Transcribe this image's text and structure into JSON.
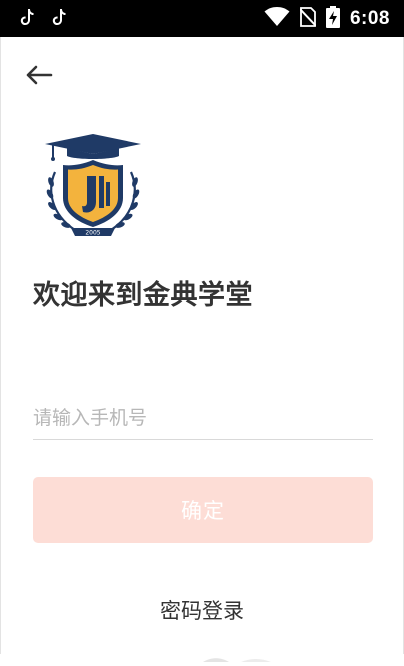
{
  "status_bar": {
    "time": "6:08",
    "icons": [
      "tiktok-icon",
      "tiktok-icon",
      "wifi-icon",
      "no-sim-icon",
      "battery-charging-icon"
    ]
  },
  "header": {
    "back_icon": "arrow-left-icon"
  },
  "logo": {
    "year_text": "2005",
    "colors": {
      "navy": "#1f3a66",
      "gold": "#f3b33d"
    }
  },
  "main": {
    "welcome_title": "欢迎来到金典学堂",
    "phone_input": {
      "value": "",
      "placeholder": "请输入手机号"
    },
    "confirm_label": "确定",
    "password_login_label": "密码登录"
  },
  "colors": {
    "confirm_bg_disabled": "#fdddd6",
    "text_dark": "#333333",
    "placeholder": "#b7b7b7"
  }
}
